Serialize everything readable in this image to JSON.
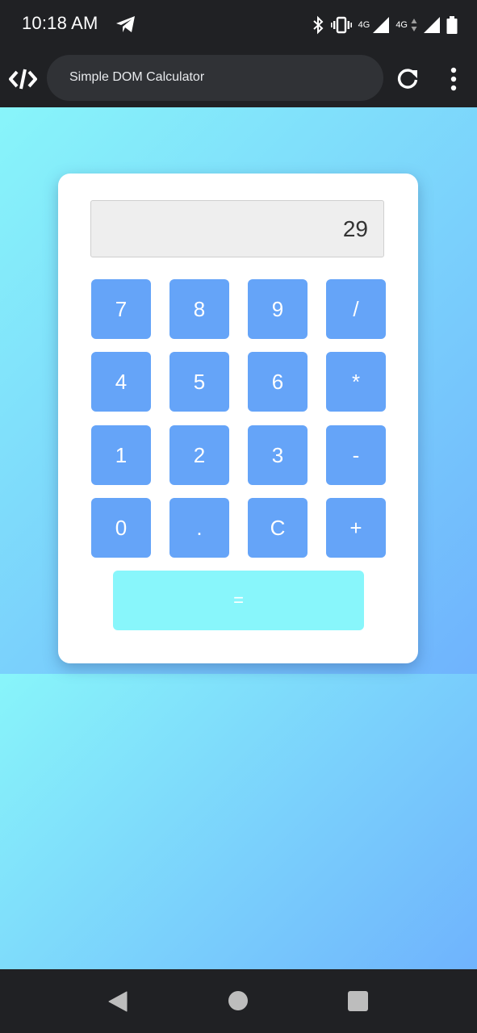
{
  "status_bar": {
    "time": "10:18 AM",
    "network_1": "4G",
    "network_2": "4G"
  },
  "browser": {
    "page_title": "Simple DOM Calculator"
  },
  "calculator": {
    "display_value": "29",
    "keys": [
      "7",
      "8",
      "9",
      "/",
      "4",
      "5",
      "6",
      "*",
      "1",
      "2",
      "3",
      "-",
      "0",
      ".",
      "C",
      "+"
    ],
    "equals_label": "="
  },
  "colors": {
    "key_blue": "#65a4f8",
    "equals_cyan": "#88f6fb",
    "gradient_start": "#88f5fa",
    "gradient_end": "#6fb3fd"
  },
  "icons": {
    "status": [
      "telegram-icon",
      "bluetooth-icon",
      "vibrate-icon",
      "signal-icon",
      "battery-icon"
    ],
    "browser": [
      "app-logo-icon",
      "reload-icon",
      "menu-icon"
    ],
    "navigation": [
      "nav-back-icon",
      "nav-home-icon",
      "nav-recents-icon"
    ]
  }
}
